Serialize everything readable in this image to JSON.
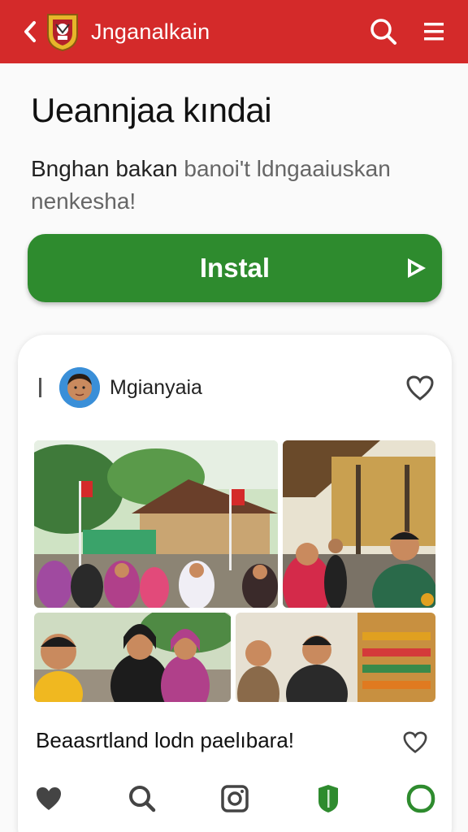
{
  "header": {
    "back_icon": "chevron-left-icon",
    "emblem": "garuda-emblem",
    "title": "Jnganalkain",
    "search_icon": "search-icon",
    "menu_icon": "menu-icon",
    "background": "#d42a2a"
  },
  "main": {
    "headline": "Ueannjaa kındai",
    "subline_part1": "Bnghan bakan",
    "subline_part2": "banoi't ldngaaiuskan nenkesha!",
    "install_label": "Instal",
    "install_color": "#2e8b2e"
  },
  "post": {
    "username": "Mgianyaia",
    "caption": "Beaasrtland lodn paelıbara!",
    "photos": [
      "village-gathering-photo",
      "market-vendor-photo",
      "villagers-smiling-photo",
      "shop-owners-photo"
    ]
  },
  "bottom_nav": {
    "items": [
      "heart-icon",
      "search-icon",
      "camera-icon",
      "shield-icon",
      "circle-icon"
    ],
    "active_color": "#2e8b2e"
  }
}
